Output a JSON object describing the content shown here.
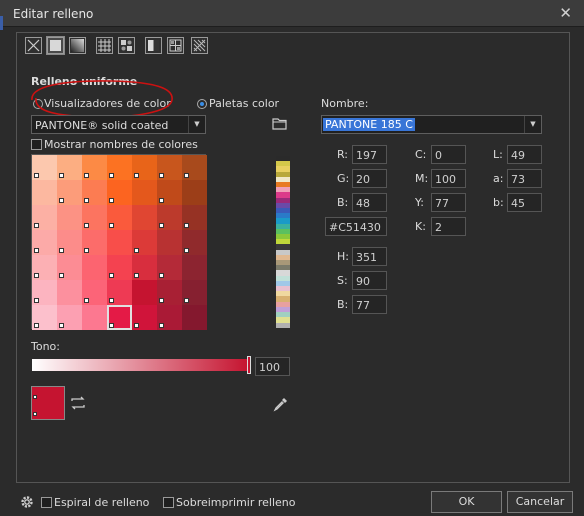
{
  "window": {
    "title": "Editar relleno"
  },
  "fill_types": [
    "no-fill-icon",
    "uniform-fill-icon",
    "fountain-fill-icon",
    "vector-pattern-icon",
    "bitmap-pattern-icon",
    "two-color-pattern-icon",
    "texture-fill-icon",
    "postscript-fill-icon"
  ],
  "uniform": {
    "group_label": "Relleno uniforme",
    "viewers_label": "Visualizadores de color",
    "palettes_label": "Paletas color",
    "palette_value": "PANTONE® solid coated",
    "show_names_label": "Mostrar nombres de colores",
    "name_label": "Nombre:",
    "name_value": "PANTONE 185 C"
  },
  "values": {
    "r_label": "R:",
    "r": "197",
    "g_label": "G:",
    "g": "20",
    "b_label": "B:",
    "b": "48",
    "c_label": "C:",
    "c": "0",
    "m_label": "M:",
    "m": "100",
    "y_label": "Y:",
    "y": "77",
    "k_label": "K:",
    "k": "2",
    "l_label": "L:",
    "l": "49",
    "a_label": "a:",
    "a": "73",
    "lb_label": "b:",
    "lb": "45",
    "hex": "#C51430",
    "h_label": "H:",
    "h": "351",
    "s_label": "S:",
    "s": "90",
    "v_label": "B:",
    "v": "77"
  },
  "tint": {
    "label": "Tono:",
    "value": "100"
  },
  "footer": {
    "spiral_label": "Espiral de relleno",
    "overprint_label": "Sobreimprimir relleno",
    "ok": "OK",
    "cancel": "Cancelar"
  },
  "colors": {
    "current": "#c51430",
    "selection": "#3875d7",
    "annotation": "#cc1111"
  },
  "swatches": [
    [
      "#fcc8ae",
      "#fcae82",
      "#fc8a45",
      "#fc7222",
      "#e86419",
      "#c8561d",
      "#a84a1c"
    ],
    [
      "#fcb8a0",
      "#fc9c7a",
      "#fc7c52",
      "#fc6420",
      "#e4581c",
      "#c04a1a",
      "#9c3e18"
    ],
    [
      "#fcb0a4",
      "#fc9284",
      "#fc7460",
      "#fa5a3c",
      "#e04632",
      "#bc3a2c",
      "#963224"
    ],
    [
      "#fcaaa8",
      "#fc8c8a",
      "#fc6c6a",
      "#f84e4a",
      "#dc3a38",
      "#b83232",
      "#902a2c"
    ],
    [
      "#fcb0b4",
      "#fc8c94",
      "#fc6470",
      "#f44250",
      "#d82e3e",
      "#b42a38",
      "#8c2430"
    ],
    [
      "#fcb4c0",
      "#fc909e",
      "#fc6478",
      "#ee3a54",
      "#c51430",
      "#a82034",
      "#862030"
    ],
    [
      "#fcc0cc",
      "#fca0b2",
      "#fc7890",
      "#e41a46",
      "#d0143a",
      "#aa1a36",
      "#84182e"
    ]
  ],
  "dots": [
    [
      0,
      1,
      2,
      3,
      4,
      5,
      6
    ],
    [
      1,
      2,
      3,
      5
    ],
    [
      0,
      2,
      3,
      5,
      6
    ],
    [
      0,
      1,
      2,
      4,
      6
    ],
    [
      0,
      1,
      3,
      4,
      5
    ],
    [
      0,
      2,
      3,
      5,
      6
    ],
    [
      0,
      1,
      3,
      4,
      5
    ]
  ],
  "selected_swatch": [
    6,
    3
  ],
  "strip_colors": [
    "#2a2a2a",
    "#d4c84a",
    "#e8d060",
    "#b8a83a",
    "#f0e8c8",
    "#e87a22",
    "#f0a0b8",
    "#dc3a8a",
    "#9a2a7a",
    "#6a4aa8",
    "#3a5ab8",
    "#2a7ac8",
    "#1a9ac8",
    "#3ab0a0",
    "#5ac060",
    "#8ac83a",
    "#c0d83a",
    "#3a3a3a",
    "#c8c8c8",
    "#e0b890",
    "#a89878",
    "#7a7a6a",
    "#d8d8d8",
    "#c0e0d8",
    "#a0c8e8",
    "#e8c0d0",
    "#f0d8a0",
    "#d8b070",
    "#e8a0a0",
    "#c0a0d8",
    "#a0d0c0",
    "#e0e090",
    "#b0b0b0"
  ]
}
